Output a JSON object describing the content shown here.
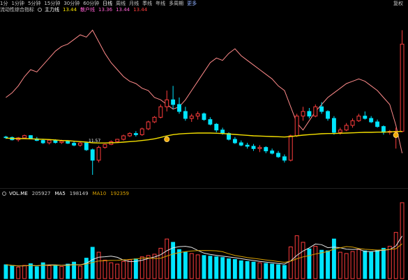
{
  "toolbar": {
    "items": [
      "1分",
      "1分钟",
      "5分钟",
      "15分钟",
      "30分钟",
      "60分钟",
      "日线",
      "周线",
      "月线",
      "季线",
      "年线",
      "多周期",
      "更多"
    ],
    "active_index": 6,
    "right_label": "复权"
  },
  "info": {
    "indicator_name": "流动性综合指标",
    "series1_label": "主力线",
    "series1_value": "13.44",
    "series2_label": "散户线",
    "series2_value": "13.36",
    "series3_value": "13.44",
    "series4_value": "13.44"
  },
  "price_low_label": "11.57",
  "volume": {
    "label": "VOL.ME",
    "value": "205927",
    "ma5_label": "MA5",
    "ma5_value": "198149",
    "ma10_label": "MA10",
    "ma10_value": "192359"
  },
  "colors": {
    "up": "#ff3d3d",
    "down": "#00e5ff",
    "ma_yellow": "#f5e000",
    "pink_line": "#ff8a8a",
    "vol_white": "#e6e6e6",
    "vol_orange": "#d9a200"
  },
  "chart_data": {
    "type": "candlestick",
    "candles": [
      [
        13.2,
        13.25,
        13.12,
        13.18
      ],
      [
        13.18,
        13.22,
        13.05,
        13.08
      ],
      [
        13.08,
        13.2,
        13.0,
        13.16
      ],
      [
        13.16,
        13.3,
        13.12,
        13.26
      ],
      [
        13.26,
        13.28,
        13.1,
        13.12
      ],
      [
        13.12,
        13.2,
        13.02,
        13.05
      ],
      [
        13.05,
        13.12,
        12.9,
        12.95
      ],
      [
        12.95,
        13.1,
        12.88,
        13.06
      ],
      [
        13.06,
        13.1,
        12.92,
        12.96
      ],
      [
        12.96,
        13.08,
        12.9,
        13.02
      ],
      [
        13.02,
        13.06,
        12.9,
        12.93
      ],
      [
        12.93,
        13.02,
        12.8,
        12.85
      ],
      [
        12.85,
        12.98,
        12.78,
        12.94
      ],
      [
        12.94,
        12.96,
        12.6,
        12.65
      ],
      [
        12.65,
        12.7,
        11.57,
        12.2
      ],
      [
        12.2,
        12.82,
        12.1,
        12.75
      ],
      [
        12.75,
        12.9,
        12.7,
        12.88
      ],
      [
        12.88,
        13.05,
        12.85,
        13.0
      ],
      [
        13.0,
        13.12,
        12.95,
        13.1
      ],
      [
        13.1,
        13.3,
        13.05,
        13.25
      ],
      [
        13.25,
        13.4,
        13.2,
        13.35
      ],
      [
        13.35,
        13.45,
        13.22,
        13.3
      ],
      [
        13.3,
        13.6,
        13.25,
        13.55
      ],
      [
        13.55,
        13.9,
        13.5,
        13.85
      ],
      [
        13.85,
        14.1,
        13.8,
        14.05
      ],
      [
        14.05,
        14.6,
        14.0,
        14.5
      ],
      [
        14.5,
        15.2,
        14.3,
        14.8
      ],
      [
        14.8,
        15.4,
        14.4,
        14.6
      ],
      [
        14.6,
        14.9,
        14.2,
        14.3
      ],
      [
        14.3,
        14.5,
        13.9,
        14.0
      ],
      [
        14.0,
        14.2,
        13.85,
        14.1
      ],
      [
        14.1,
        14.3,
        13.95,
        14.2
      ],
      [
        14.2,
        14.25,
        13.9,
        13.95
      ],
      [
        13.95,
        14.05,
        13.7,
        13.75
      ],
      [
        13.75,
        13.8,
        13.4,
        13.5
      ],
      [
        13.5,
        13.6,
        13.3,
        13.35
      ],
      [
        13.35,
        13.4,
        13.05,
        13.1
      ],
      [
        13.1,
        13.2,
        12.9,
        12.95
      ],
      [
        12.95,
        13.05,
        12.8,
        12.85
      ],
      [
        12.85,
        12.95,
        12.7,
        12.8
      ],
      [
        12.8,
        12.9,
        12.6,
        12.7
      ],
      [
        12.7,
        12.85,
        12.55,
        12.75
      ],
      [
        12.75,
        12.8,
        12.5,
        12.6
      ],
      [
        12.6,
        12.7,
        12.45,
        12.5
      ],
      [
        12.5,
        12.6,
        12.3,
        12.35
      ],
      [
        12.35,
        12.45,
        12.1,
        12.2
      ],
      [
        12.2,
        13.3,
        12.15,
        13.25
      ],
      [
        13.25,
        14.2,
        13.2,
        14.1
      ],
      [
        14.1,
        14.5,
        13.9,
        14.3
      ],
      [
        14.3,
        14.45,
        14.0,
        14.1
      ],
      [
        14.1,
        14.6,
        14.05,
        14.5
      ],
      [
        14.5,
        14.7,
        14.2,
        14.3
      ],
      [
        14.3,
        14.35,
        13.9,
        14.0
      ],
      [
        14.0,
        14.1,
        13.3,
        13.4
      ],
      [
        13.4,
        13.6,
        13.3,
        13.5
      ],
      [
        13.5,
        13.8,
        13.45,
        13.7
      ],
      [
        13.7,
        14.0,
        13.6,
        13.9
      ],
      [
        13.9,
        14.2,
        13.85,
        14.1
      ],
      [
        14.1,
        14.3,
        13.95,
        14.0
      ],
      [
        14.0,
        14.1,
        13.8,
        13.85
      ],
      [
        13.85,
        13.95,
        13.6,
        13.65
      ],
      [
        13.65,
        13.7,
        13.3,
        13.4
      ],
      [
        13.4,
        13.5,
        13.3,
        13.44
      ],
      [
        13.44,
        13.6,
        12.7,
        13.44
      ],
      [
        13.44,
        17.8,
        13.4,
        17.2
      ]
    ],
    "ma": [
      13.15,
      13.14,
      13.13,
      13.13,
      13.12,
      13.11,
      13.1,
      13.09,
      13.07,
      13.05,
      13.04,
      13.02,
      13.0,
      12.98,
      12.95,
      12.94,
      12.94,
      12.95,
      12.96,
      12.98,
      13.0,
      13.02,
      13.05,
      13.08,
      13.12,
      13.18,
      13.25,
      13.3,
      13.33,
      13.35,
      13.36,
      13.37,
      13.37,
      13.37,
      13.36,
      13.35,
      13.33,
      13.31,
      13.29,
      13.27,
      13.25,
      13.24,
      13.23,
      13.22,
      13.21,
      13.2,
      13.22,
      13.25,
      13.28,
      13.3,
      13.32,
      13.34,
      13.35,
      13.35,
      13.36,
      13.37,
      13.38,
      13.39,
      13.4,
      13.4,
      13.41,
      13.41,
      13.42,
      13.43,
      13.44
    ],
    "pink": [
      14.9,
      15.1,
      15.4,
      15.8,
      16.1,
      16.0,
      16.3,
      16.6,
      16.9,
      17.1,
      17.2,
      17.4,
      17.6,
      17.5,
      17.8,
      17.3,
      16.8,
      16.4,
      16.1,
      15.8,
      15.6,
      15.5,
      15.3,
      15.2,
      14.9,
      14.8,
      14.6,
      14.4,
      14.5,
      14.8,
      15.2,
      15.6,
      16.0,
      16.4,
      16.6,
      16.5,
      16.8,
      17.0,
      16.7,
      16.5,
      16.3,
      16.1,
      15.9,
      15.7,
      15.4,
      15.2,
      14.5,
      13.8,
      13.5,
      13.9,
      14.3,
      14.6,
      14.9,
      15.1,
      15.3,
      15.5,
      15.6,
      15.7,
      15.6,
      15.4,
      15.2,
      14.9,
      14.6,
      13.7,
      12.5
    ],
    "volumes": [
      42,
      38,
      35,
      40,
      45,
      36,
      48,
      39,
      41,
      37,
      44,
      50,
      38,
      62,
      95,
      80,
      56,
      48,
      44,
      52,
      57,
      60,
      66,
      70,
      74,
      92,
      120,
      110,
      88,
      80,
      76,
      72,
      70,
      68,
      66,
      64,
      60,
      58,
      54,
      52,
      50,
      48,
      46,
      44,
      42,
      40,
      96,
      130,
      110,
      90,
      98,
      86,
      84,
      120,
      80,
      76,
      82,
      88,
      84,
      80,
      86,
      92,
      98,
      140,
      230
    ]
  }
}
